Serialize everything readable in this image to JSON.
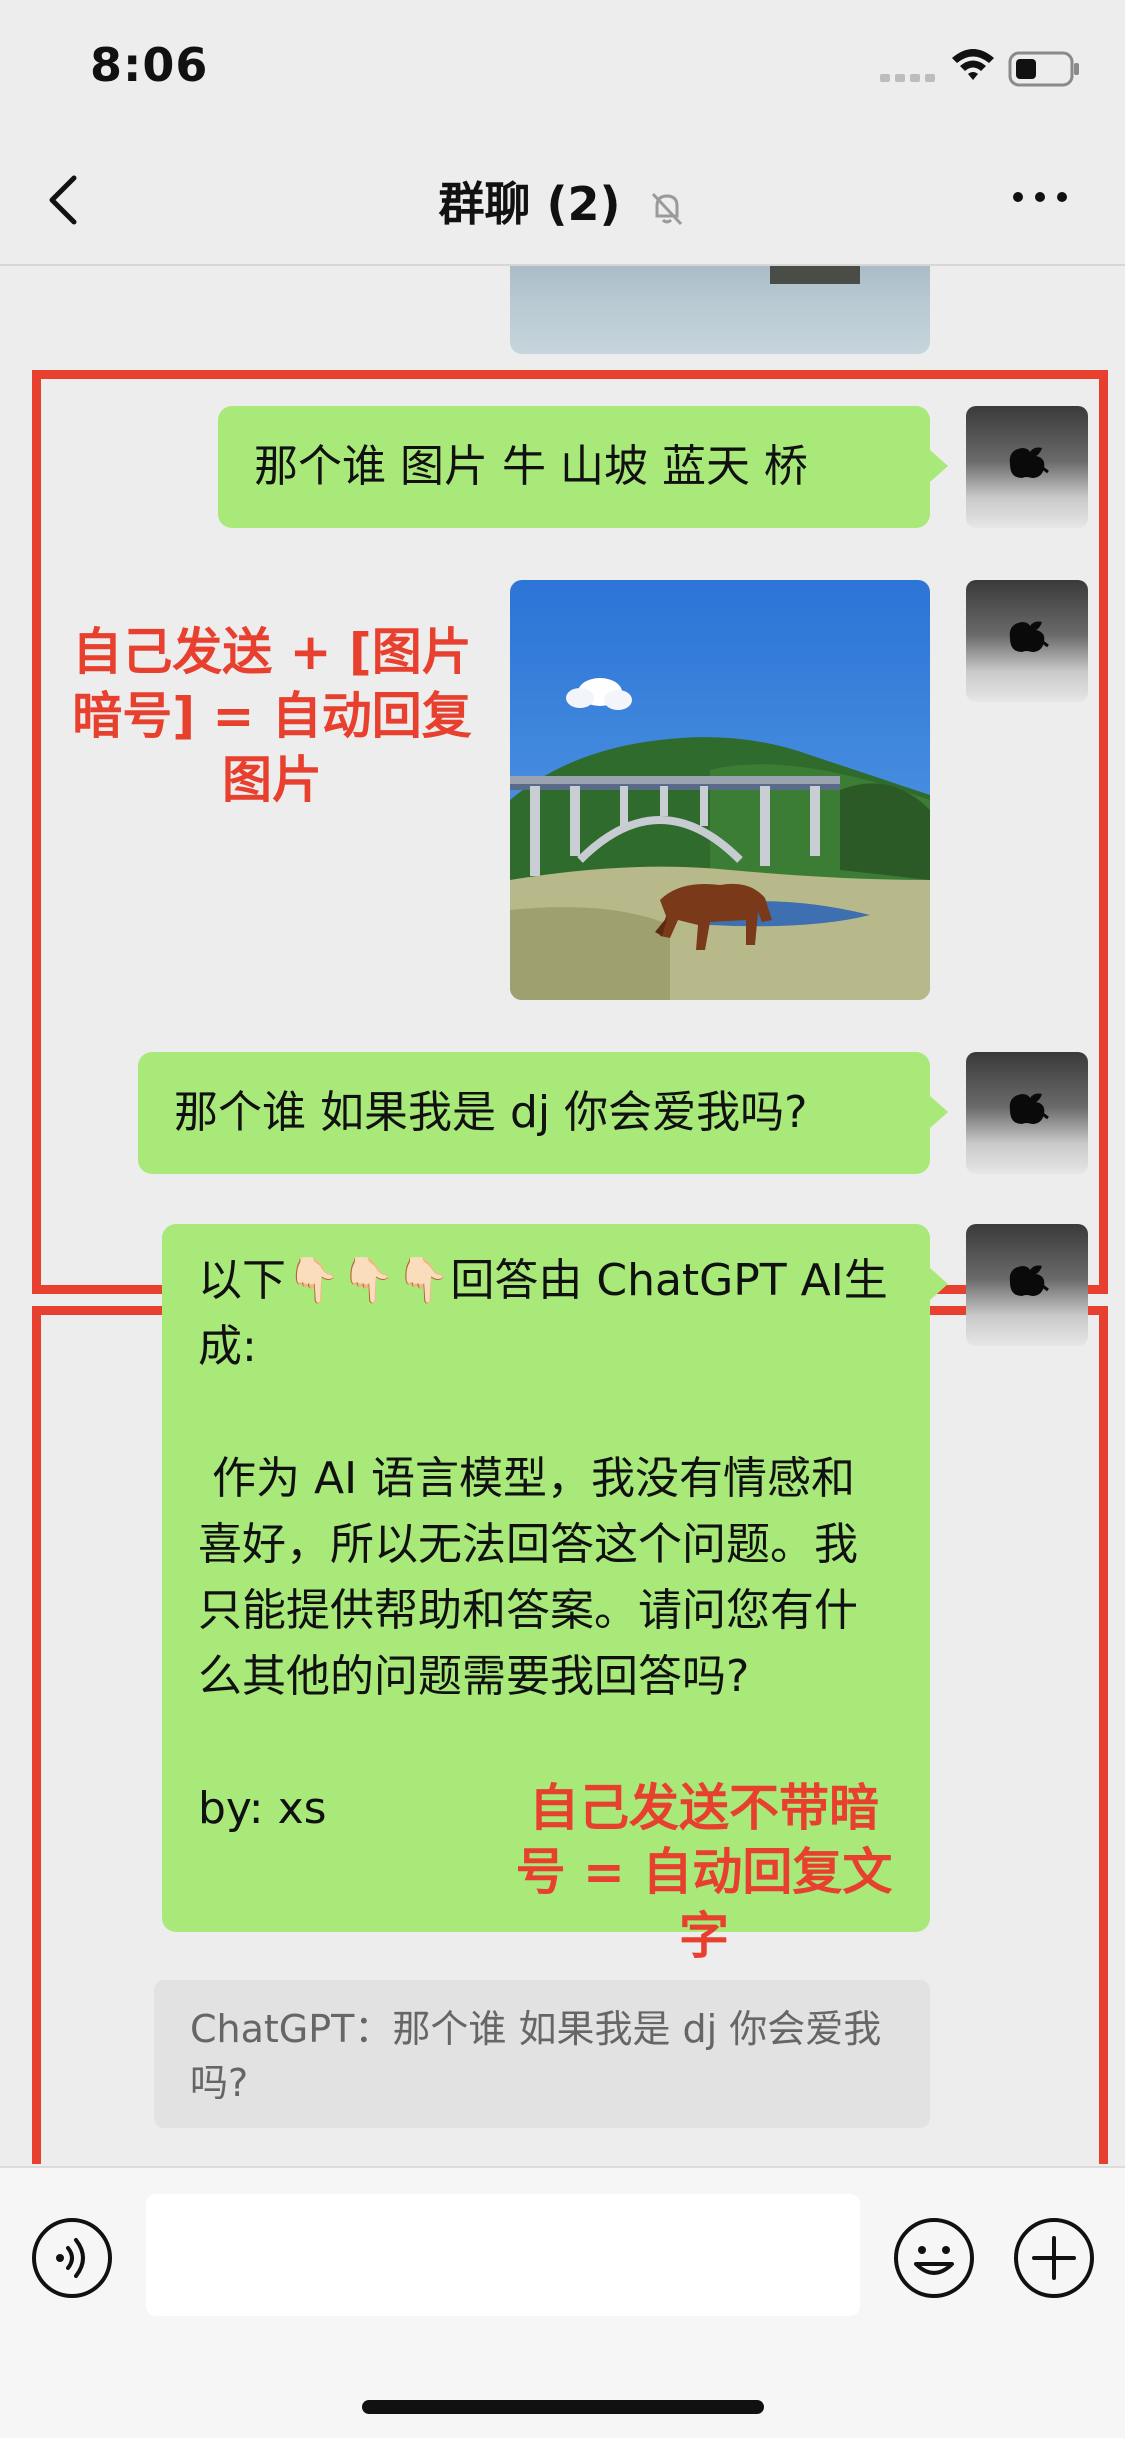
{
  "status": {
    "time": "8:06"
  },
  "nav": {
    "title": "群聊 (2)"
  },
  "messages": {
    "m1_text": "那个谁 图片 牛 山坡 蓝天 桥",
    "m3_text": "那个谁 如果我是 dj 你会爱我吗?",
    "m4_text": "以下👇🏻👇🏻👇🏻回答由 ChatGPT AI生成:\n\n 作为 AI 语言模型，我没有情感和喜好，所以无法回答这个问题。我只能提供帮助和答案。请问您有什么其他的问题需要我回答吗?\n\nby: xs",
    "quote_text": "ChatGPT：那个谁 如果我是 dj 你会爱我吗?"
  },
  "annotations": {
    "box1": "自己发送 + [图片暗号] = 自动回复图片",
    "box2": "自己发送不带暗号 = 自动回复文字"
  },
  "input": {
    "value": ""
  },
  "colors": {
    "bubble": "#a8e97a",
    "annotation": "#e8402e",
    "background": "#ededed"
  },
  "icons": [
    "signal-icon",
    "wifi-icon",
    "battery-icon",
    "back-icon",
    "mute-icon",
    "more-icon",
    "voice-icon",
    "emoji-icon",
    "plus-icon"
  ]
}
